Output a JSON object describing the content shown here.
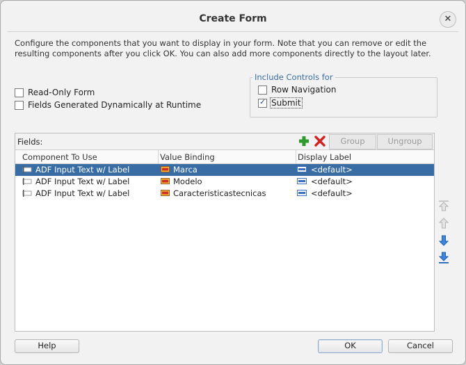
{
  "window": {
    "title": "Create Form",
    "close_glyph": "✕"
  },
  "description": "Configure the components that you want to display in your form. Note that you can remove or edit the resulting components after you click OK. You can also add more components directly to the layout later.",
  "options": {
    "read_only_label": "Read-Only Form",
    "read_only_checked": false,
    "dynamic_label": "Fields Generated Dynamically at Runtime",
    "dynamic_checked": false
  },
  "include_controls": {
    "title": "Include Controls for",
    "row_navigation_label": "Row Navigation",
    "row_navigation_checked": false,
    "submit_label": "Submit",
    "submit_checked": true
  },
  "fields": {
    "label": "Fields:",
    "group_label": "Group",
    "ungroup_label": "Ungroup",
    "columns": [
      "Component To Use",
      "Value Binding",
      "Display Label"
    ],
    "rows": [
      {
        "component": "ADF Input Text w/ Label",
        "binding": "Marca",
        "display": "<default>",
        "selected": true
      },
      {
        "component": "ADF Input Text w/ Label",
        "binding": "Modelo",
        "display": "<default>",
        "selected": false
      },
      {
        "component": "ADF Input Text w/ Label",
        "binding": "Caracteristicastecnicas",
        "display": "<default>",
        "selected": false
      }
    ]
  },
  "buttons": {
    "help": "Help",
    "ok": "OK",
    "cancel": "Cancel"
  },
  "colors": {
    "accent": "#386ca4",
    "add_green": "#2e9a2e",
    "remove_red": "#d32020",
    "arrow_blue": "#2a6fd0"
  }
}
